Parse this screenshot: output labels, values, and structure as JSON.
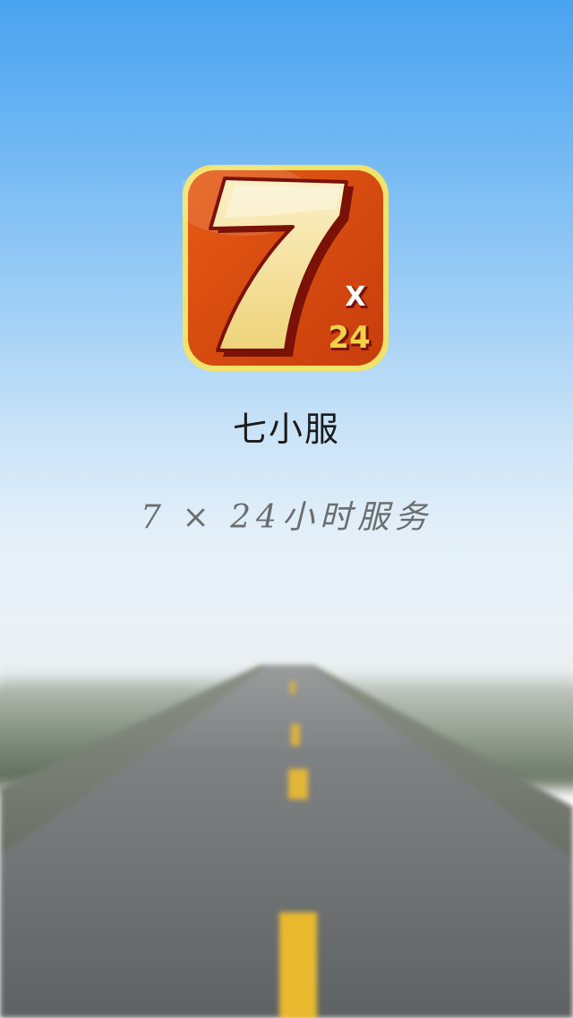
{
  "splash": {
    "app_name": "七小服",
    "tagline": "7 × 24小时服务"
  },
  "logo": {
    "icon": "lucky-seven-logo",
    "main_glyph": "7",
    "badge_top": "X",
    "badge_bottom": "24",
    "colors": {
      "tile_outer": "#f2e36a",
      "tile_fill": "#e55a14",
      "tile_fill_dark": "#c83d0c",
      "seven_fill": "#f5e7a8",
      "seven_outline": "#7a1208",
      "badge_text": "#f3d24a"
    }
  },
  "colors": {
    "sky_top": "#4aa3ef",
    "sky_bottom": "#eef3f6",
    "road": "#6d6f70",
    "road_line": "#e9b92f",
    "app_name_text": "#1b1b1b",
    "tagline_text": "#6b6e6f"
  }
}
